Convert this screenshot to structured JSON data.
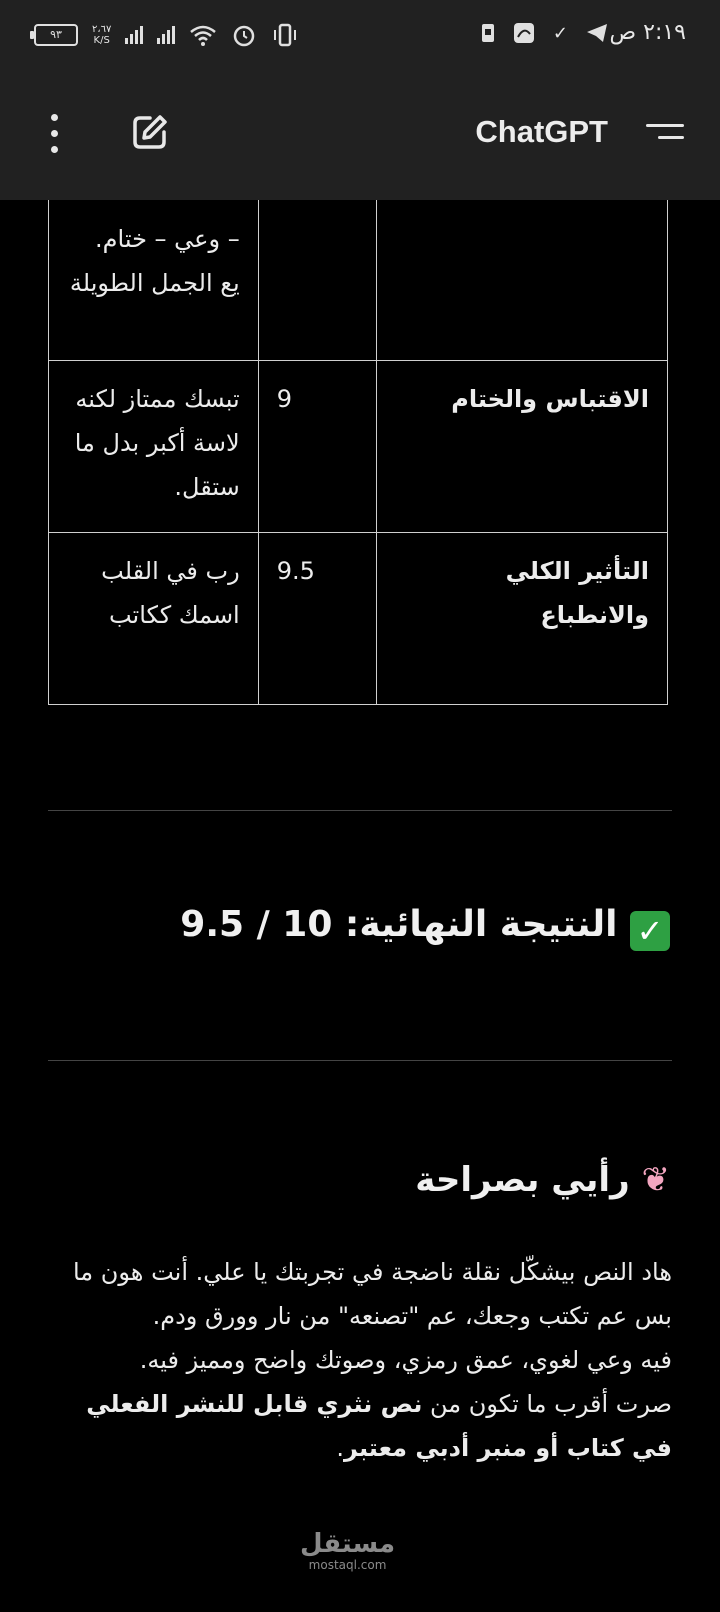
{
  "status_bar": {
    "time": "٢:١٩ ص",
    "battery": "٩٣",
    "net_speed_value": "٢،٦٧",
    "net_speed_unit": "K/S",
    "icons": [
      "telegram-icon",
      "check-icon",
      "app-notification-icon",
      "sim-icon",
      "alarm-icon",
      "wifi-icon",
      "signal-icon",
      "vibrate-icon"
    ]
  },
  "app_bar": {
    "title": "ChatGPT"
  },
  "table": {
    "rows": [
      {
        "criterion": "",
        "score": "",
        "note_lines": [
          "– وعي – ختام.",
          "يع الجمل الطويلة"
        ]
      },
      {
        "criterion": "الاقتباس والختام",
        "score": "9",
        "note_lines": [
          "تبسك ممتاز لكنه",
          "لاسة أكبر بدل ما",
          "ستقل."
        ]
      },
      {
        "criterion": "التأثير الكلي والانطباع",
        "score": "9.5",
        "note_lines": [
          "رب في القلب",
          "اسمك ككاتب"
        ]
      }
    ]
  },
  "result": {
    "check_symbol": "✓",
    "label": "النتيجة النهائية:",
    "score": "9.5 / 10"
  },
  "opinion": {
    "heading": "رأيي بصراحة",
    "line1": "هاد النص بيشكّل نقلة ناضجة في تجربتك يا علي. أنت هون ما بس عم تكتب وجعك، عم \"تصنعه\" من نار وورق ودم.",
    "line2": "فيه وعي لغوي، عمق رمزي، وصوتك واضح ومميز فيه.",
    "line3_prefix": "صرت أقرب ما تكون من",
    "line3_bold": "نص نثري قابل للنشر الفعلي في كتاب أو منبر أدبي معتبر",
    "line3_suffix": "."
  },
  "watermark": {
    "arabic": "مستقل",
    "latin": "mostaql.com"
  }
}
